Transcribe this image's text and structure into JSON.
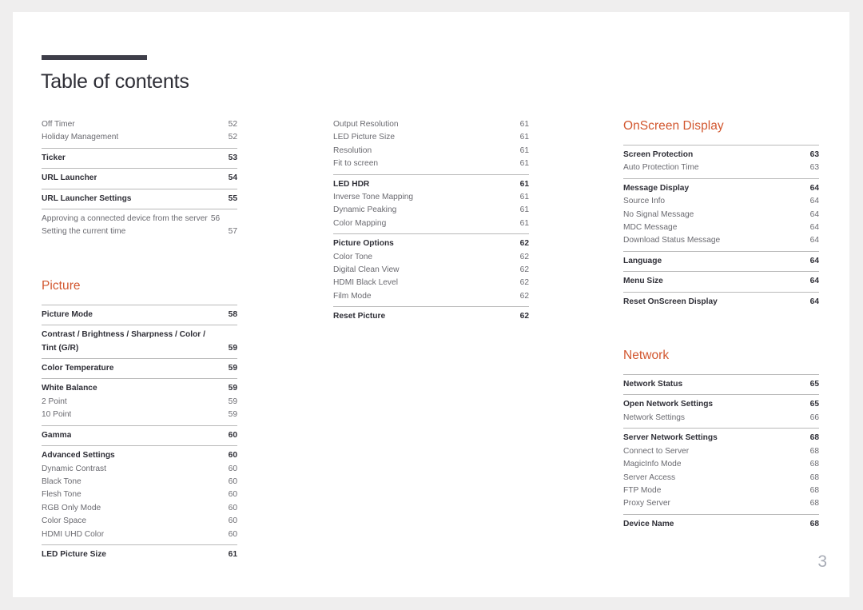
{
  "document": {
    "title": "Table of contents",
    "page_number": "3",
    "accent_color": "#d2572f",
    "rule_color": "#3e3e49",
    "heading_color": "#2d2d35"
  },
  "columns": [
    {
      "id": "column-1",
      "blocks": [
        {
          "type": "group",
          "rule": false,
          "entries": [
            {
              "label": "Off Timer",
              "page": "52",
              "level": 2
            },
            {
              "label": "Holiday Management",
              "page": "52",
              "level": 2
            }
          ]
        },
        {
          "type": "group",
          "rule": true,
          "entries": [
            {
              "label": "Ticker",
              "page": "53",
              "level": 1
            }
          ]
        },
        {
          "type": "group",
          "rule": true,
          "entries": [
            {
              "label": "URL Launcher",
              "page": "54",
              "level": 1
            }
          ]
        },
        {
          "type": "group",
          "rule": true,
          "entries": [
            {
              "label": "URL Launcher Settings",
              "page": "55",
              "level": 1
            }
          ]
        },
        {
          "type": "group",
          "rule": true,
          "entries": [
            {
              "label": "Approving a connected device from the server",
              "page": "56",
              "level": 2,
              "tight": true
            },
            {
              "label": "Setting the current time",
              "page": "57",
              "level": 2
            }
          ]
        },
        {
          "type": "heading",
          "label": "Picture",
          "gap_before": true
        },
        {
          "type": "group",
          "rule": true,
          "entries": [
            {
              "label": "Picture Mode",
              "page": "58",
              "level": 1
            }
          ]
        },
        {
          "type": "group",
          "rule": true,
          "entries": [
            {
              "label": "Contrast / Brightness / Sharpness / Color /",
              "label2": "Tint (G/R)",
              "page": "59",
              "level": 1,
              "wrap": true
            }
          ]
        },
        {
          "type": "group",
          "rule": true,
          "entries": [
            {
              "label": "Color Temperature",
              "page": "59",
              "level": 1
            }
          ]
        },
        {
          "type": "group",
          "rule": true,
          "entries": [
            {
              "label": "White Balance",
              "page": "59",
              "level": 1
            },
            {
              "label": "2 Point",
              "page": "59",
              "level": 2
            },
            {
              "label": "10 Point",
              "page": "59",
              "level": 2
            }
          ]
        },
        {
          "type": "group",
          "rule": true,
          "entries": [
            {
              "label": "Gamma",
              "page": "60",
              "level": 1
            }
          ]
        },
        {
          "type": "group",
          "rule": true,
          "entries": [
            {
              "label": "Advanced Settings",
              "page": "60",
              "level": 1
            },
            {
              "label": "Dynamic Contrast",
              "page": "60",
              "level": 2
            },
            {
              "label": "Black Tone",
              "page": "60",
              "level": 2
            },
            {
              "label": "Flesh Tone",
              "page": "60",
              "level": 2
            },
            {
              "label": "RGB Only Mode",
              "page": "60",
              "level": 2
            },
            {
              "label": "Color Space",
              "page": "60",
              "level": 2
            },
            {
              "label": "HDMI UHD Color",
              "page": "60",
              "level": 2
            }
          ]
        },
        {
          "type": "group",
          "rule": true,
          "entries": [
            {
              "label": "LED Picture Size",
              "page": "61",
              "level": 1
            }
          ]
        }
      ]
    },
    {
      "id": "column-2",
      "blocks": [
        {
          "type": "group",
          "rule": false,
          "entries": [
            {
              "label": "Output Resolution",
              "page": "61",
              "level": 2
            },
            {
              "label": "LED Picture Size",
              "page": "61",
              "level": 2
            },
            {
              "label": "Resolution",
              "page": "61",
              "level": 2
            },
            {
              "label": "Fit to screen",
              "page": "61",
              "level": 2
            }
          ]
        },
        {
          "type": "group",
          "rule": true,
          "entries": [
            {
              "label": "LED HDR",
              "page": "61",
              "level": 1
            },
            {
              "label": "Inverse Tone Mapping",
              "page": "61",
              "level": 2
            },
            {
              "label": "Dynamic Peaking",
              "page": "61",
              "level": 2
            },
            {
              "label": "Color Mapping",
              "page": "61",
              "level": 2
            }
          ]
        },
        {
          "type": "group",
          "rule": true,
          "entries": [
            {
              "label": "Picture Options",
              "page": "62",
              "level": 1
            },
            {
              "label": "Color Tone",
              "page": "62",
              "level": 2
            },
            {
              "label": "Digital Clean View",
              "page": "62",
              "level": 2
            },
            {
              "label": "HDMI Black Level",
              "page": "62",
              "level": 2
            },
            {
              "label": "Film Mode",
              "page": "62",
              "level": 2
            }
          ]
        },
        {
          "type": "group",
          "rule": true,
          "entries": [
            {
              "label": "Reset Picture",
              "page": "62",
              "level": 1
            }
          ]
        }
      ]
    },
    {
      "id": "column-3",
      "blocks": [
        {
          "type": "heading",
          "label": "OnScreen Display",
          "gap_before": false
        },
        {
          "type": "group",
          "rule": true,
          "entries": [
            {
              "label": "Screen Protection",
              "page": "63",
              "level": 1
            },
            {
              "label": "Auto Protection Time",
              "page": "63",
              "level": 2
            }
          ]
        },
        {
          "type": "group",
          "rule": true,
          "entries": [
            {
              "label": "Message Display",
              "page": "64",
              "level": 1
            },
            {
              "label": "Source Info",
              "page": "64",
              "level": 2
            },
            {
              "label": "No Signal Message",
              "page": "64",
              "level": 2
            },
            {
              "label": "MDC Message",
              "page": "64",
              "level": 2
            },
            {
              "label": "Download Status Message",
              "page": "64",
              "level": 2
            }
          ]
        },
        {
          "type": "group",
          "rule": true,
          "entries": [
            {
              "label": "Language",
              "page": "64",
              "level": 1
            }
          ]
        },
        {
          "type": "group",
          "rule": true,
          "entries": [
            {
              "label": "Menu Size",
              "page": "64",
              "level": 1
            }
          ]
        },
        {
          "type": "group",
          "rule": true,
          "entries": [
            {
              "label": "Reset OnScreen Display",
              "page": "64",
              "level": 1
            }
          ]
        },
        {
          "type": "heading",
          "label": "Network",
          "gap_before": true
        },
        {
          "type": "group",
          "rule": true,
          "entries": [
            {
              "label": "Network Status",
              "page": "65",
              "level": 1
            }
          ]
        },
        {
          "type": "group",
          "rule": true,
          "entries": [
            {
              "label": "Open Network Settings",
              "page": "65",
              "level": 1
            },
            {
              "label": "Network Settings",
              "page": "66",
              "level": 2
            }
          ]
        },
        {
          "type": "group",
          "rule": true,
          "entries": [
            {
              "label": "Server Network Settings",
              "page": "68",
              "level": 1
            },
            {
              "label": "Connect to Server",
              "page": "68",
              "level": 2
            },
            {
              "label": "MagicInfo Mode",
              "page": "68",
              "level": 2
            },
            {
              "label": "Server Access",
              "page": "68",
              "level": 2
            },
            {
              "label": "FTP Mode",
              "page": "68",
              "level": 2
            },
            {
              "label": "Proxy Server",
              "page": "68",
              "level": 2
            }
          ]
        },
        {
          "type": "group",
          "rule": true,
          "entries": [
            {
              "label": "Device Name",
              "page": "68",
              "level": 1
            }
          ]
        }
      ]
    }
  ]
}
